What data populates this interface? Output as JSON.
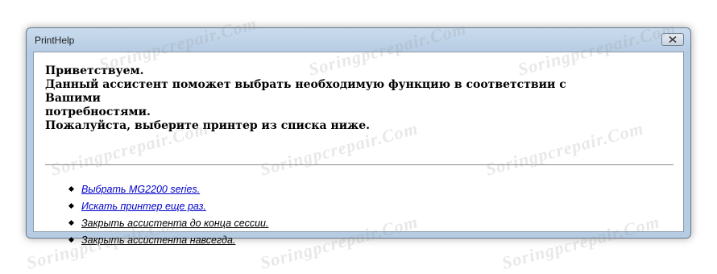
{
  "window": {
    "title": "PrintHelp"
  },
  "intro": {
    "line1": "Приветствуем.",
    "line2": "Данный ассистент поможет выбрать необходимую функцию в соответствии с Вашими",
    "line3": "потребностями.",
    "line4": "Пожалуйста, выберите принтер из списка ниже."
  },
  "links": [
    {
      "label": "Выбрать MG2200 series.",
      "color": "#0000cc"
    },
    {
      "label": "Искать принтер еще раз.",
      "color": "#0000cc"
    },
    {
      "label": "Закрыть ассистента до конца сессии.",
      "color": "#000000"
    },
    {
      "label": "Закрыть ассистента навсегда.",
      "color": "#000000"
    }
  ],
  "watermark": "Soringpcrepair.Com",
  "icons": {
    "close": "close-icon"
  }
}
